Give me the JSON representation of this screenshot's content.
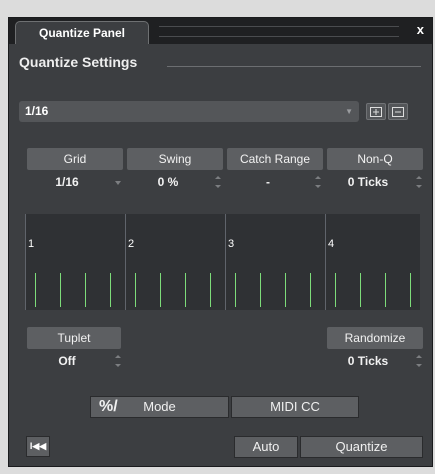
{
  "panel": {
    "tab_label": "Quantize Panel",
    "close_label": "x",
    "section_title": "Quantize Settings"
  },
  "preset": {
    "value": "1/16"
  },
  "params": {
    "grid": {
      "label": "Grid",
      "value": "1/16"
    },
    "swing": {
      "label": "Swing",
      "value": "0 %"
    },
    "catch_range": {
      "label": "Catch Range",
      "value": "-"
    },
    "non_q": {
      "label": "Non-Q",
      "value": "0 Ticks"
    },
    "tuplet": {
      "label": "Tuplet",
      "value": "Off"
    },
    "randomize": {
      "label": "Randomize",
      "value": "0 Ticks"
    }
  },
  "grid_display": {
    "bars": [
      "1",
      "2",
      "3",
      "4"
    ],
    "ticks_per_bar": 4,
    "tick_color": "#7ddc7a"
  },
  "buttons": {
    "mode_icon": "%/",
    "mode": "Mode",
    "midi_cc": "MIDI CC",
    "auto": "Auto",
    "quantize": "Quantize",
    "rewind": "I◀◀"
  }
}
